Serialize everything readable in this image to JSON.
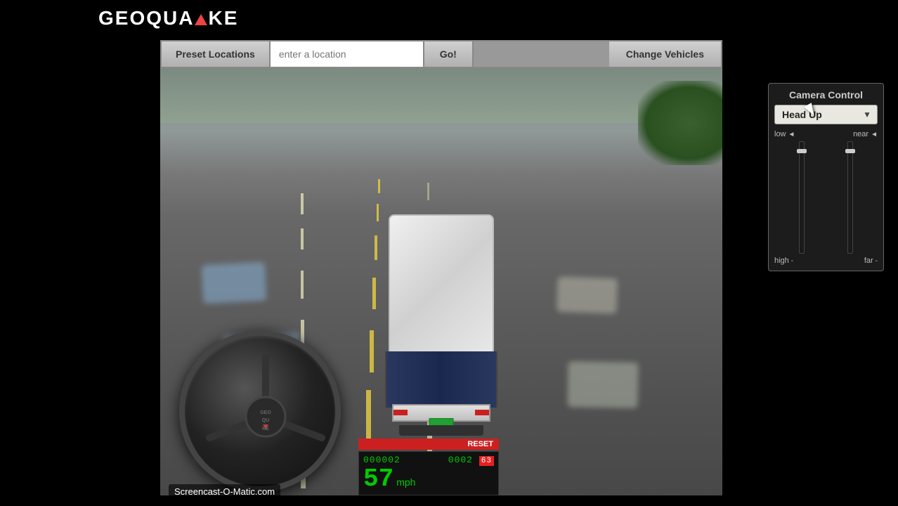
{
  "app": {
    "title": "GEOQUAKE",
    "logo_text_1": "GEOQUA",
    "logo_text_2": "KE"
  },
  "toolbar": {
    "preset_label": "Preset Locations",
    "location_placeholder": "enter a location",
    "go_label": "Go!",
    "vehicles_label": "Change Vehicles"
  },
  "camera": {
    "title": "Camera Control",
    "mode_label": "Head Up",
    "low_label": "low",
    "near_label": "near",
    "high_label": "high",
    "far_label": "far"
  },
  "speedometer": {
    "reset_label": "RESET",
    "odometer": "000002",
    "trip": "0002",
    "speed": "57",
    "unit": "mph",
    "gear": "63"
  },
  "watermark": {
    "text": "Screencast-O-Matic.com"
  }
}
